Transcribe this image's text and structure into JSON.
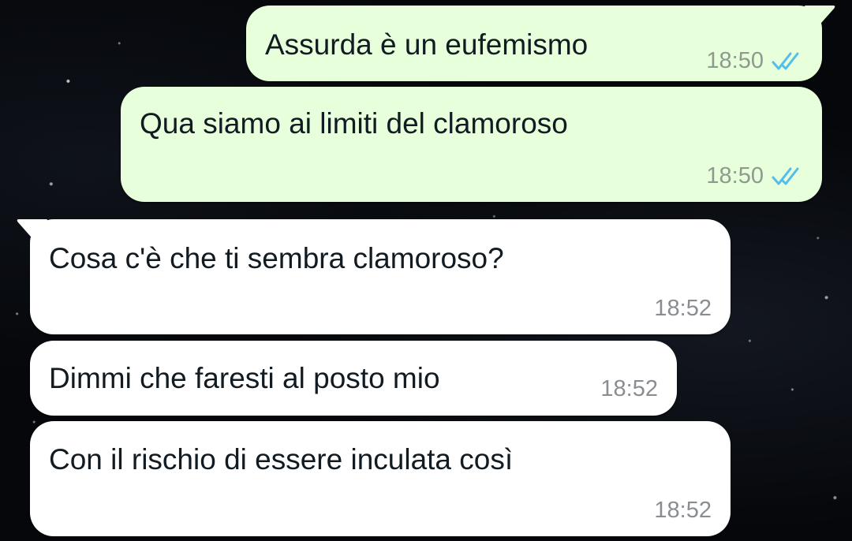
{
  "chat": {
    "messages": [
      {
        "direction": "outgoing",
        "text": "Assurda è un eufemismo",
        "time": "18:50",
        "read_icon": "double-check-read-icon"
      },
      {
        "direction": "outgoing",
        "text": "Qua siamo ai limiti del clamoroso",
        "time": "18:50",
        "read_icon": "double-check-read-icon"
      },
      {
        "direction": "incoming",
        "text": "Cosa c'è che ti sembra clamoroso?",
        "time": "18:52"
      },
      {
        "direction": "incoming",
        "text": "Dimmi che faresti al posto mio",
        "time": "18:52"
      },
      {
        "direction": "incoming",
        "text": "Con il rischio di essere inculata così",
        "time": "18:52"
      }
    ]
  },
  "colors": {
    "outgoing_bubble": "#e7ffdb",
    "incoming_bubble": "#ffffff",
    "read_ticks": "#53bdeb",
    "background": "#05070a"
  }
}
